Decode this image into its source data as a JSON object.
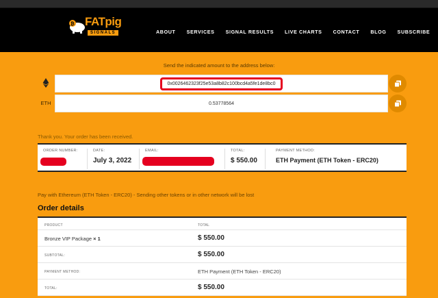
{
  "header": {
    "logo": {
      "brand": "FATpig",
      "tagline": "SIGNALS"
    },
    "nav": [
      "ABOUT",
      "SERVICES",
      "SIGNAL RESULTS",
      "LIVE CHARTS",
      "CONTACT",
      "BLOG",
      "SUBSCRIBE"
    ]
  },
  "payment": {
    "instruction": "Send the indicated amount to the address below:",
    "address": "0x0026462323f25e53a8b82c100bcd4a5fe1de8bc0",
    "currency_label": "ETH",
    "amount": "0.53778564"
  },
  "confirmation": {
    "thanks": "Thank you. Your order has been received.",
    "order_number_label": "ORDER NUMBER:",
    "date_label": "DATE:",
    "date_value": "July 3, 2022",
    "email_label": "EMAIL:",
    "total_label": "TOTAL:",
    "total_value": "$ 550.00",
    "method_label": "PAYMENT METHOD:",
    "method_value": "ETH Payment (ETH Token - ERC20)"
  },
  "notice": "Pay with Ethereum (ETH Token - ERC20) - Sending other tokens or in other network will be lost",
  "order_details": {
    "title": "Order details",
    "col_product": "PRODUCT",
    "col_total": "TOTAL",
    "product_name": "Bronze VIP Package",
    "product_qty": "× 1",
    "product_total": "$ 550.00",
    "subtotal_label": "SUBTOTAL:",
    "subtotal_value": "$ 550.00",
    "method_label": "PAYMENT METHOD:",
    "method_value": "ETH Payment (ETH Token - ERC20)",
    "total_label": "TOTAL:",
    "total_value": "$ 550.00"
  },
  "colors": {
    "background": "#F99C0F",
    "header": "#000000",
    "redaction": "#E5001F",
    "highlight": "#E5001F"
  }
}
